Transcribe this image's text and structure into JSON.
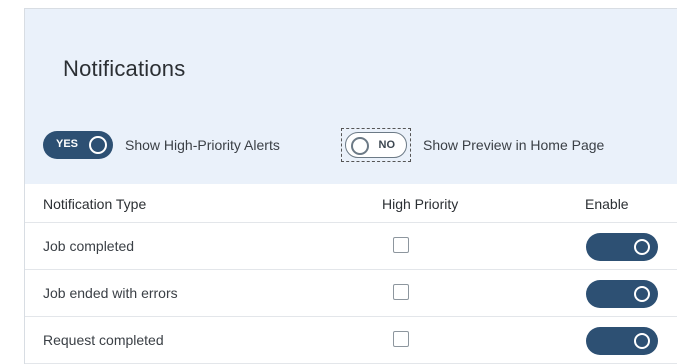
{
  "header": {
    "title": "Notifications",
    "switches": [
      {
        "state_label": "YES",
        "label": "Show High-Priority Alerts",
        "on": true
      },
      {
        "state_label": "NO",
        "label": "Show Preview in Home Page",
        "on": false
      }
    ]
  },
  "table": {
    "columns": [
      "Notification Type",
      "High Priority",
      "Enable"
    ],
    "rows": [
      {
        "type": "Job completed",
        "high_priority": false,
        "enabled": true
      },
      {
        "type": "Job ended with errors",
        "high_priority": false,
        "enabled": true
      },
      {
        "type": "Request completed",
        "high_priority": false,
        "enabled": true
      }
    ]
  },
  "colors": {
    "accent": "#2d5073",
    "header_bg": "#eaf1fa"
  }
}
